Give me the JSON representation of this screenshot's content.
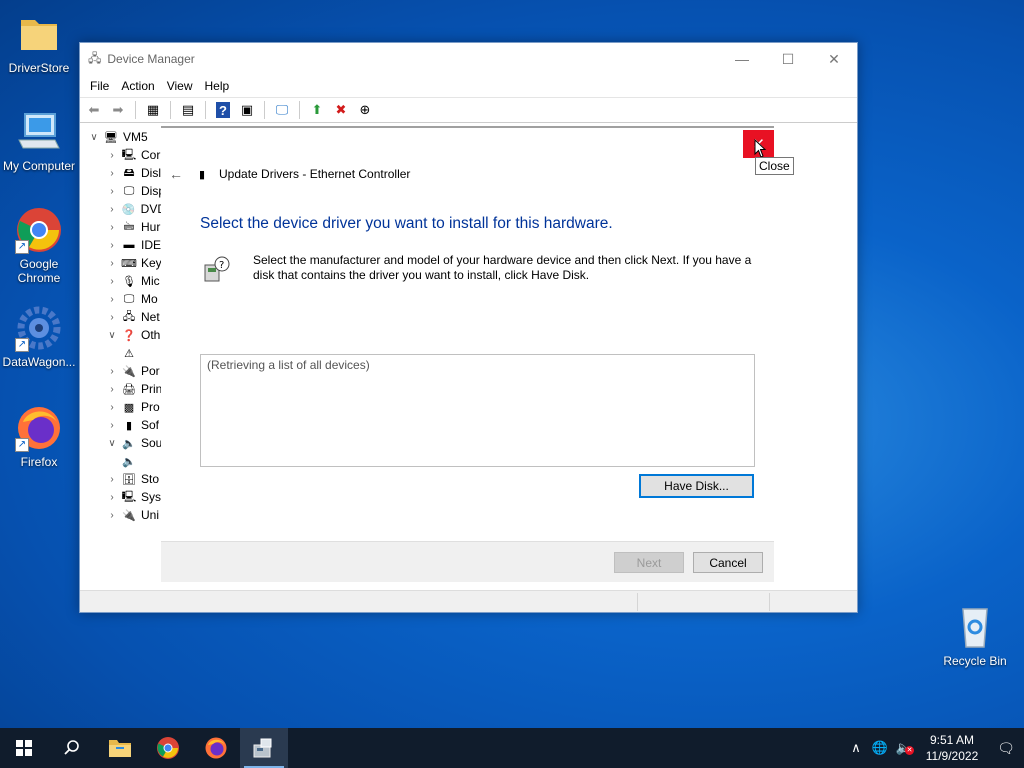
{
  "desktop": {
    "icons": [
      {
        "label": "DriverStore",
        "icon": "folder-icon"
      },
      {
        "label": "My Computer",
        "icon": "computer-icon"
      },
      {
        "label": "Google Chrome",
        "icon": "chrome-icon"
      },
      {
        "label": "DataWagon...",
        "icon": "gear-icon"
      },
      {
        "label": "Firefox",
        "icon": "firefox-icon"
      },
      {
        "label": "Recycle Bin",
        "icon": "recycle-bin-icon"
      }
    ]
  },
  "window": {
    "title": "Device Manager",
    "menu": [
      "File",
      "Action",
      "View",
      "Help"
    ],
    "tree": {
      "root": "VM5",
      "items": [
        {
          "label": "Cor",
          "expanded": false
        },
        {
          "label": "Disl",
          "expanded": false
        },
        {
          "label": "Disp",
          "expanded": false
        },
        {
          "label": "DVD",
          "expanded": false
        },
        {
          "label": "Hur",
          "expanded": false
        },
        {
          "label": "IDE",
          "expanded": false
        },
        {
          "label": "Key",
          "expanded": false
        },
        {
          "label": "Mic",
          "expanded": false
        },
        {
          "label": "Mo",
          "expanded": false
        },
        {
          "label": "Net",
          "expanded": false
        },
        {
          "label": "Oth",
          "expanded": true
        },
        {
          "label": "",
          "child": true
        },
        {
          "label": "Por",
          "expanded": false
        },
        {
          "label": "Prin",
          "expanded": false
        },
        {
          "label": "Pro",
          "expanded": false
        },
        {
          "label": "Sof",
          "expanded": false
        },
        {
          "label": "Sou",
          "expanded": true
        },
        {
          "label": "",
          "child": true
        },
        {
          "label": "Sto",
          "expanded": false
        },
        {
          "label": "Syst",
          "expanded": false
        },
        {
          "label": "Uni",
          "expanded": false
        }
      ]
    }
  },
  "dialog": {
    "header": "Update Drivers - Ethernet Controller",
    "title": "Select the device driver you want to install for this hardware.",
    "description": "Select the manufacturer and model of your hardware device and then click Next. If you have a disk that contains the driver you want to install, click Have Disk.",
    "list_status": "(Retrieving a list of all devices)",
    "have_disk_label": "Have Disk...",
    "next_label": "Next",
    "cancel_label": "Cancel",
    "close_tooltip": "Close"
  },
  "taskbar": {
    "time": "9:51 AM",
    "date": "11/9/2022"
  },
  "colors": {
    "accent": "#0078d7",
    "close_red": "#e81123",
    "title_blue": "#003399"
  }
}
